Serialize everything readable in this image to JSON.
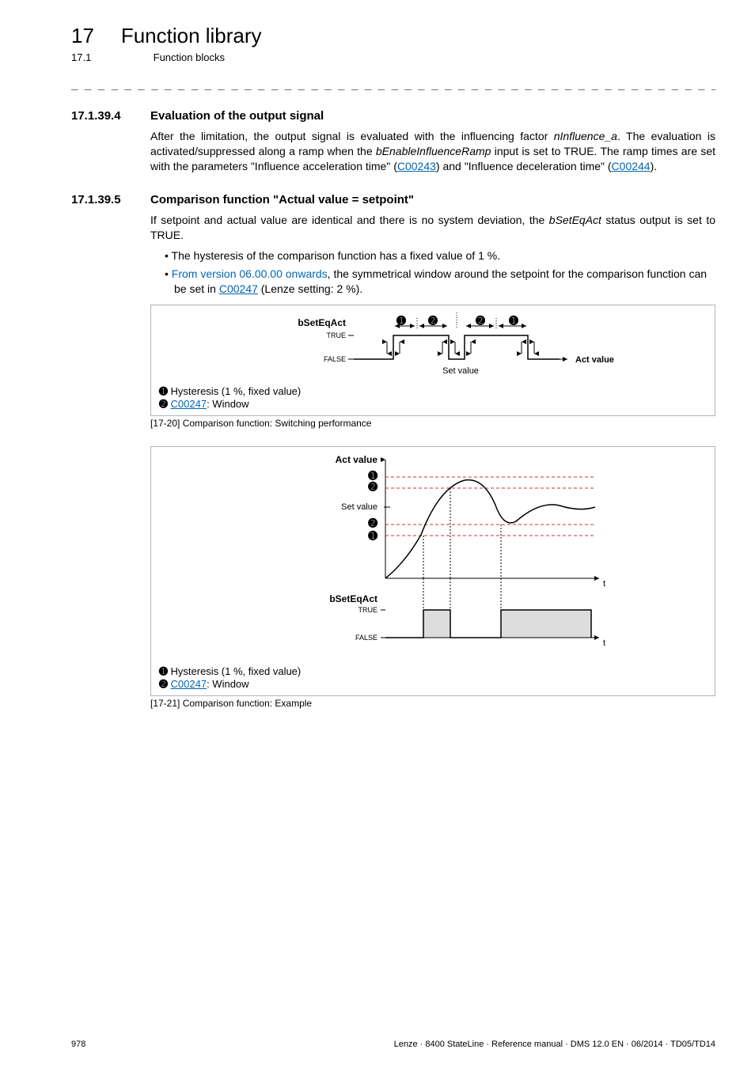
{
  "header": {
    "chapter_num": "17",
    "chapter_title": "Function library",
    "section_num": "17.1",
    "section_title": "Function blocks"
  },
  "sec_a": {
    "num": "17.1.39.4",
    "title": "Evaluation of the output signal",
    "p1_pre": "After the limitation, the output signal is evaluated with the influencing factor ",
    "p1_var": "nInfluence_a",
    "p1_mid": ". The evaluation is activated/suppressed along a ramp when the ",
    "p1_var2": "bEnableInfluenceRamp",
    "p1_mid2": " input is set to TRUE. The ramp times are set with the parameters \"Influence acceleration time\" (",
    "p1_link1": "C00243",
    "p1_mid3": ") and \"Influence deceleration time\" (",
    "p1_link2": "C00244",
    "p1_post": ")."
  },
  "sec_b": {
    "num": "17.1.39.5",
    "title": "Comparison function \"Actual value = setpoint\"",
    "p1_pre": "If setpoint and actual value are identical and there is no system deviation, the ",
    "p1_var": "bSetEqAct",
    "p1_post": " status output is set to TRUE.",
    "b1": "The hysteresis of the comparison function has a fixed value of 1 %.",
    "b2_blue": "From version 06.00.00 onwards",
    "b2_mid": ", the symmetrical window around the setpoint for the comparison function can be set in ",
    "b2_link": "C00247",
    "b2_post": " (Lenze setting: 2 %)."
  },
  "fig1": {
    "caption_tag": "[17-20]",
    "caption_text": " Comparison function: Switching performance",
    "signal_label": "bSetEqAct",
    "true_lbl": "TRUE",
    "false_lbl": "FALSE",
    "xaxis_mid": "Set value",
    "xaxis_right": "Act value",
    "legend1": " Hysteresis (1 %, fixed value)",
    "legend2_link": "C00247",
    "legend2_post": ": Window"
  },
  "fig2": {
    "caption_tag": "[17-21]",
    "caption_text": " Comparison function: Example",
    "ylabel": "Act value",
    "setvalue_lbl": "Set value",
    "signal_label": "bSetEqAct",
    "true_lbl": "TRUE",
    "false_lbl": "FALSE",
    "t_lbl": "t",
    "legend1": " Hysteresis (1 %, fixed value)",
    "legend2_link": "C00247",
    "legend2_post": ": Window"
  },
  "footer": {
    "page": "978",
    "right": "Lenze · 8400 StateLine · Reference manual · DMS 12.0 EN · 06/2014 · TD05/TD14"
  },
  "chart_data": [
    {
      "type": "step",
      "title": "Comparison function: Switching performance",
      "x_axis": "Act value",
      "set_value_position": 0.55,
      "x_range": [
        0,
        1
      ],
      "series": [
        {
          "name": "bSetEqAct",
          "values": [
            "FALSE",
            "TRUE",
            "FALSE",
            "TRUE",
            "FALSE"
          ],
          "transition_x": [
            0,
            0.3,
            0.48,
            0.58,
            0.8,
            1.0
          ]
        }
      ],
      "annotations": {
        "hysteresis_width_fraction": 0.05,
        "window_width_fraction": 0.12
      }
    },
    {
      "type": "line+step",
      "title": "Comparison function: Example",
      "x_axis": "t",
      "x_range": [
        0,
        1
      ],
      "set_value_level": 0.55,
      "hysteresis_band": [
        0.5,
        0.6
      ],
      "window_band": [
        0.44,
        0.66
      ],
      "series": [
        {
          "name": "Act value",
          "x": [
            0.0,
            0.1,
            0.2,
            0.3,
            0.4,
            0.5,
            0.6,
            0.7,
            0.8,
            0.9,
            1.0
          ],
          "y": [
            0.0,
            0.15,
            0.45,
            0.7,
            0.75,
            0.6,
            0.48,
            0.55,
            0.62,
            0.58,
            0.55
          ]
        },
        {
          "name": "bSetEqAct",
          "values": [
            "FALSE",
            "TRUE",
            "FALSE",
            "TRUE"
          ],
          "transition_x": [
            0.0,
            0.22,
            0.44,
            0.64,
            1.0
          ]
        }
      ]
    }
  ]
}
